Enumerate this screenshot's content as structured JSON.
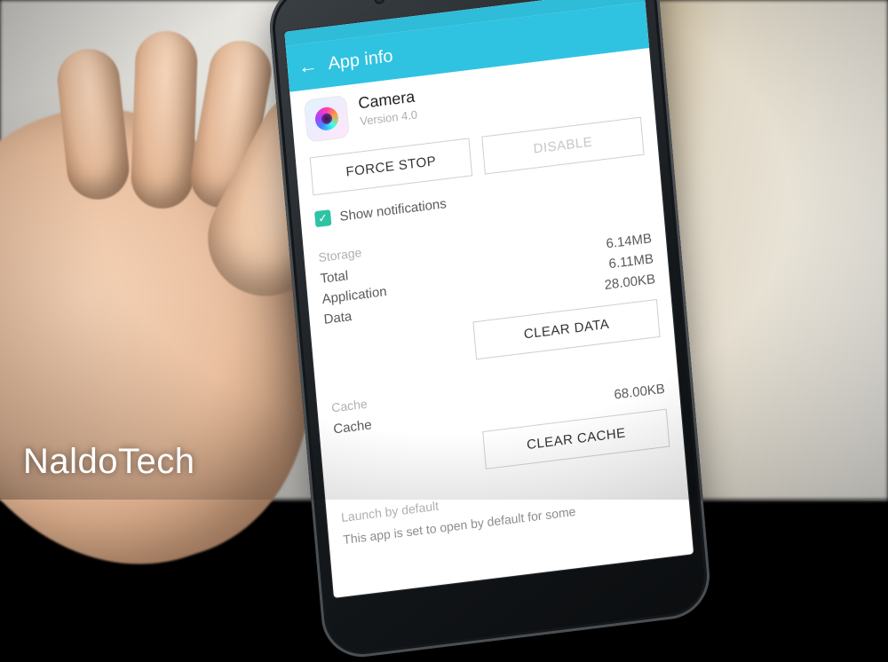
{
  "watermark": "NaldoTech",
  "header": {
    "title": "App info"
  },
  "app": {
    "name": "Camera",
    "version_label": "Version 4.0",
    "icon_name": "camera"
  },
  "buttons": {
    "force_stop": "FORCE STOP",
    "disable": "DISABLE",
    "clear_data": "CLEAR DATA",
    "clear_cache": "CLEAR CACHE"
  },
  "notifications": {
    "show_label": "Show notifications",
    "checked": true
  },
  "storage": {
    "heading": "Storage",
    "rows": {
      "total": {
        "label": "Total",
        "value": "6.14MB"
      },
      "application": {
        "label": "Application",
        "value": "6.11MB"
      },
      "data": {
        "label": "Data",
        "value": "28.00KB"
      }
    }
  },
  "cache": {
    "heading": "Cache",
    "rows": {
      "cache": {
        "label": "Cache",
        "value": "68.00KB"
      }
    }
  },
  "launch": {
    "heading": "Launch by default",
    "text": "This app is set to open by default for some"
  },
  "colors": {
    "accent": "#2fc3e1",
    "check": "#2fc3a5"
  }
}
